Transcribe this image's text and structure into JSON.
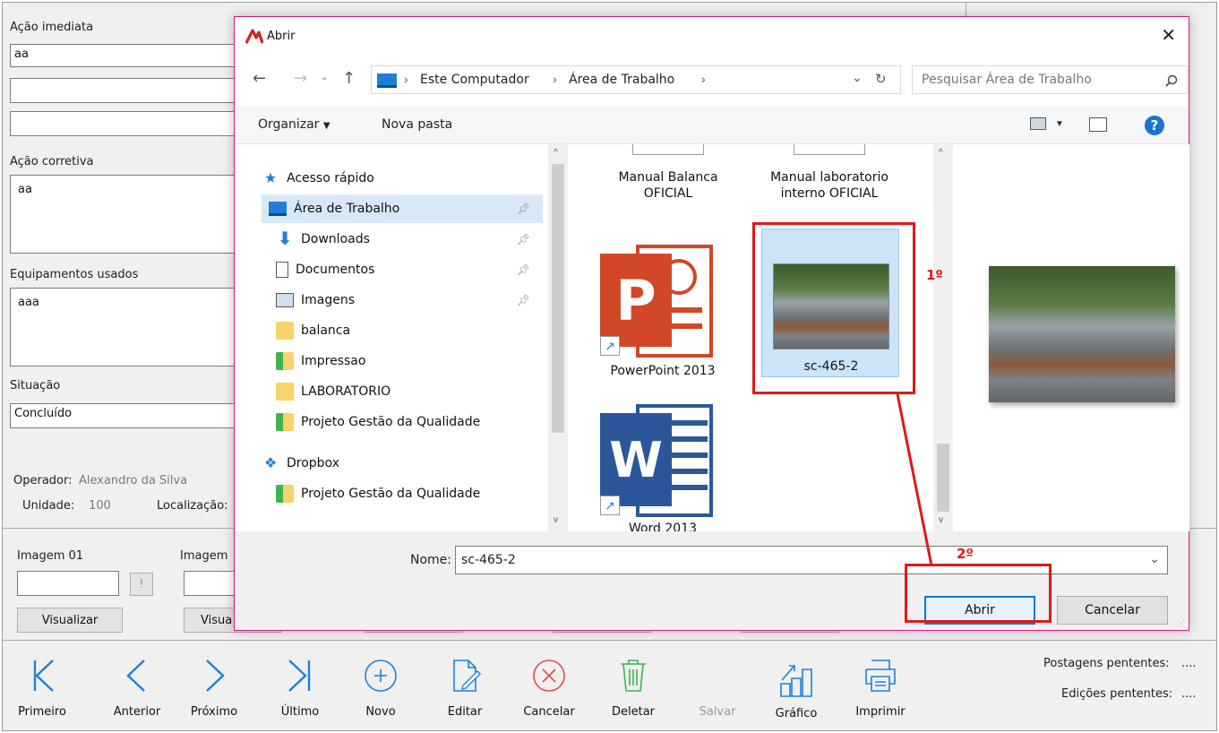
{
  "form": {
    "acao_imediata_label": "Ação imediata",
    "acao_imediata_values": [
      "aa",
      "",
      ""
    ],
    "acao_corretiva_label": "Ação corretiva",
    "acao_corretiva_value": "aa",
    "equipamentos_label": "Equipamentos usados",
    "equipamentos_value": "aaa",
    "situacao_label": "Situação",
    "situacao_value": "Concluído",
    "operador_label": "Operador:",
    "operador_value": "Alexandro da Silva",
    "unidade_label": "Unidade:",
    "unidade_value": "100",
    "localizacao_label": "Localização:",
    "imagem01_label": "Imagem 01",
    "imagem02_label": "Imagem",
    "image_browse_label": "!",
    "visualizar_label": "Visualizar",
    "visualizar2_label": "Visua"
  },
  "toolbar": {
    "items": [
      {
        "label": "Primeiro",
        "icon": "first-icon"
      },
      {
        "label": "Anterior",
        "icon": "previous-icon"
      },
      {
        "label": "Próximo",
        "icon": "next-icon"
      },
      {
        "label": "Último",
        "icon": "last-icon"
      },
      {
        "label": "Novo",
        "icon": "plus-circle-icon"
      },
      {
        "label": "Editar",
        "icon": "edit-icon"
      },
      {
        "label": "Cancelar",
        "icon": "cancel-icon"
      },
      {
        "label": "Deletar",
        "icon": "trash-icon"
      },
      {
        "label": "Salvar",
        "icon": "save-icon"
      },
      {
        "label": "Gráfico",
        "icon": "chart-icon"
      },
      {
        "label": "Imprimir",
        "icon": "printer-icon"
      }
    ],
    "postagens_label": "Postagens pententes:",
    "postagens_value": "....",
    "edicoes_label": "Edições pententes:",
    "edicoes_value": "...."
  },
  "dialog": {
    "title": "Abrir",
    "path": [
      "Este Computador",
      "Área de Trabalho"
    ],
    "search_placeholder": "Pesquisar Área de Trabalho",
    "organize_label": "Organizar",
    "new_folder_label": "Nova pasta",
    "nav_items": [
      {
        "label": "Acesso rápido",
        "icon": "quick-access-star-icon"
      },
      {
        "label": "Área de Trabalho",
        "icon": "desktop-icon",
        "pinned": true,
        "selected": true
      },
      {
        "label": "Downloads",
        "icon": "download-arrow-icon",
        "pinned": true
      },
      {
        "label": "Documentos",
        "icon": "document-icon",
        "pinned": true
      },
      {
        "label": "Imagens",
        "icon": "pictures-icon",
        "pinned": true
      },
      {
        "label": "balanca",
        "icon": "folder-icon"
      },
      {
        "label": "Impressao",
        "icon": "synced-folder-icon"
      },
      {
        "label": "LABORATORIO",
        "icon": "folder-icon"
      },
      {
        "label": "Projeto Gestão da Qualidade",
        "icon": "synced-folder-icon"
      },
      {
        "label": "Dropbox",
        "icon": "dropbox-icon"
      },
      {
        "label": "Projeto Gestão da Qualidade",
        "icon": "synced-folder-icon"
      }
    ],
    "files": [
      {
        "label": "Manual Balanca OFICIAL"
      },
      {
        "label": "Manual laboratorio interno OFICIAL"
      },
      {
        "label": "PowerPoint 2013"
      },
      {
        "label": "sc-465-2"
      },
      {
        "label": "Word 2013"
      }
    ],
    "filename_label": "Nome:",
    "filename_value": "sc-465-2",
    "open_label": "Abrir",
    "cancel_label": "Cancelar"
  },
  "annotations": {
    "step1": "1º",
    "step2": "2º"
  },
  "colors": {
    "dialog_border": "#d6198f",
    "annotation_red": "#e01919",
    "selection_blue": "#cce4f7",
    "toolbar_icon_blue": "#1e7fd8",
    "cancel_red": "#e5484d",
    "trash_green": "#3fb34f"
  }
}
